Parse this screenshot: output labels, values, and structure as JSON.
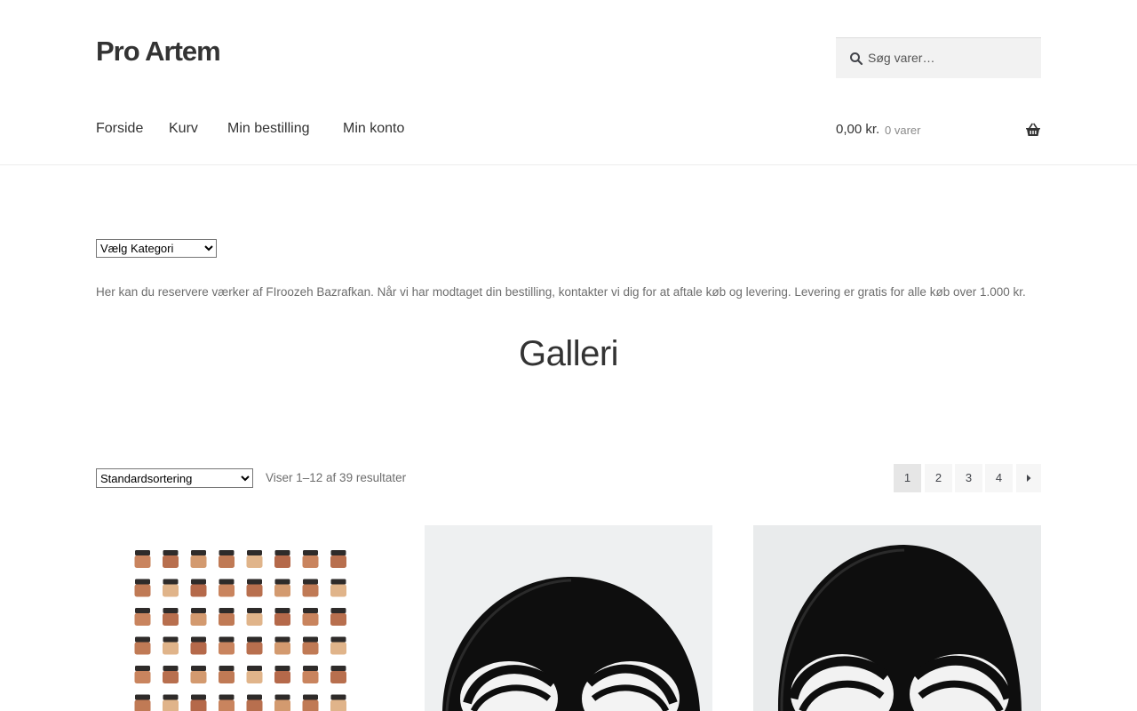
{
  "site": {
    "title": "Pro Artem"
  },
  "search": {
    "placeholder": "Søg varer…"
  },
  "nav": {
    "items": [
      "Forside",
      "Kurv",
      "Min bestilling",
      "Min konto"
    ]
  },
  "cart": {
    "total": "0,00 kr.",
    "count": "0 varer"
  },
  "category_filter": {
    "selected": "Vælg Kategori"
  },
  "intro": "Her kan du reservere værker af FIroozeh Bazrafkan. Når vi har modtaget din bestilling, kontakter vi dig for at aftale køb og levering. Levering er gratis for alle køb over 1.000 kr.",
  "page_title": "Galleri",
  "sorting": {
    "selected": "Standardsortering",
    "result_count": "Viser 1–12 af 39 resultater"
  },
  "pagination": {
    "pages": [
      "1",
      "2",
      "3",
      "4"
    ],
    "current": "1"
  },
  "products": [
    {
      "image": "jars-grid"
    },
    {
      "image": "ink-face"
    },
    {
      "image": "ink-face"
    }
  ]
}
